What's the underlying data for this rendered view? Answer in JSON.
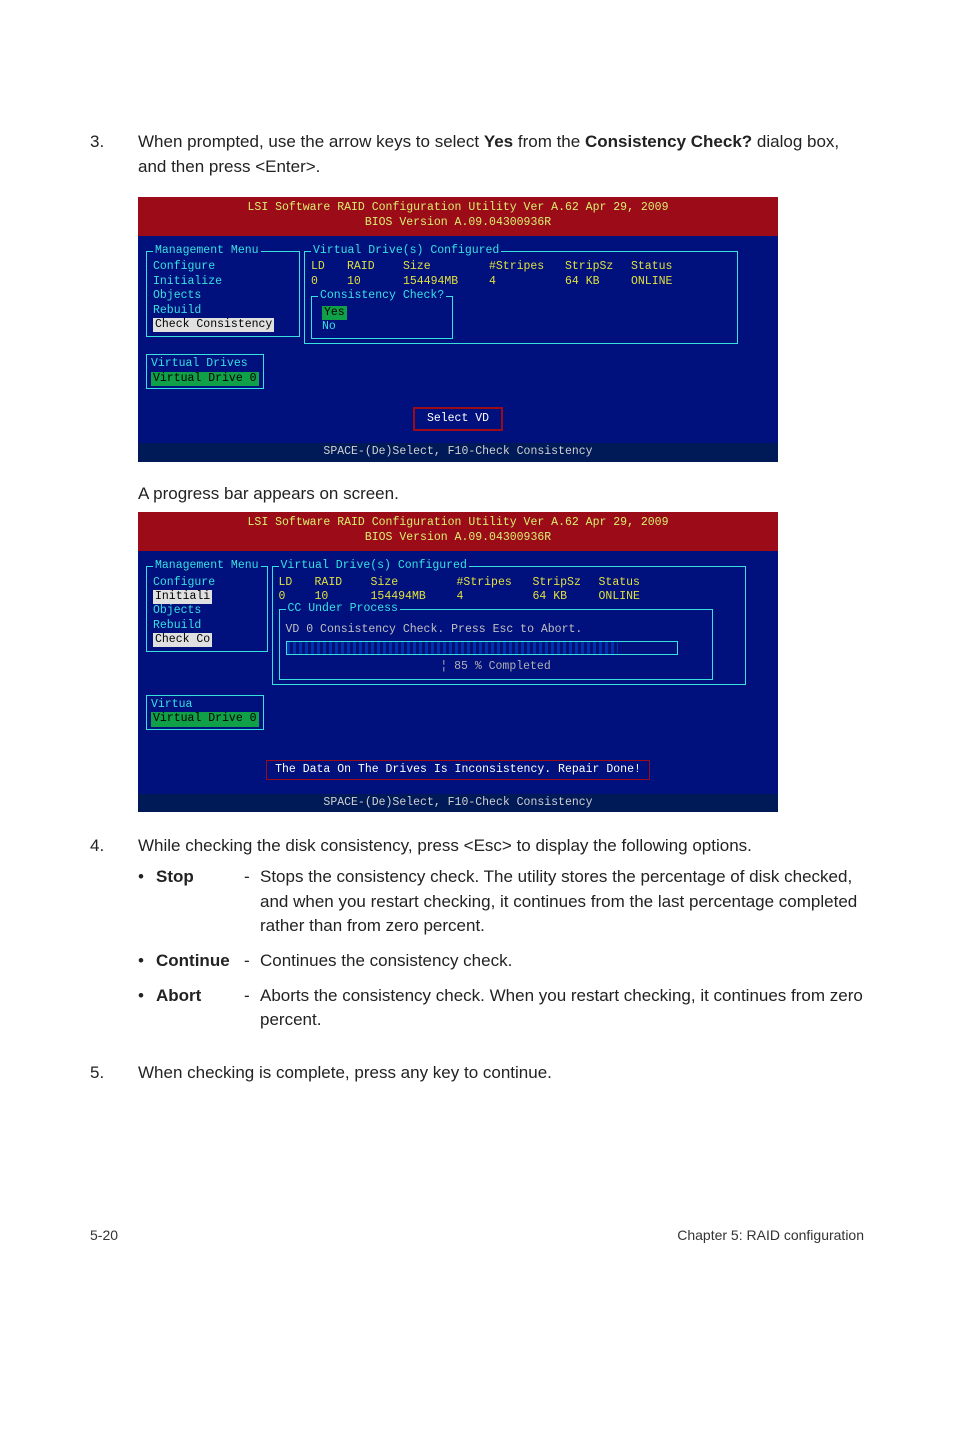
{
  "step3": {
    "num": "3.",
    "text_parts": {
      "p1": "When prompted, use the arrow keys to select ",
      "yes": "Yes",
      "p2": " from the ",
      "cc": "Consistency Check?",
      "p3": " dialog box, and then press <Enter>."
    }
  },
  "term1": {
    "header_line1": "LSI Software RAID Configuration Utility Ver A.62 Apr 29, 2009",
    "header_line2": "BIOS Version   A.09.04300936R",
    "vd_title": "Virtual Drive(s) Configured",
    "mgmt_title": "Management Menu",
    "mgmt_items": [
      "Configure",
      "Initialize",
      "Objects",
      "Rebuild",
      "Check Consistency"
    ],
    "vd_drives_title": "Virtual Drives",
    "vd_drive0": "Virtual Drive 0",
    "cols": {
      "ld": "LD",
      "raid": "RAID",
      "size": "Size",
      "stripes": "#Stripes",
      "stripsz": "StripSz",
      "status": "Status"
    },
    "row": {
      "ld": "0",
      "raid": "10",
      "size": "154494MB",
      "stripes": "4",
      "stripsz": "64 KB",
      "status": "ONLINE"
    },
    "cc_title": "Consistency Check?",
    "cc_yes": "Yes",
    "cc_no": "No",
    "select_vd": "Select VD",
    "footer": "SPACE-(De)Select,    F10-Check Consistency"
  },
  "caption1": "A progress bar appears on screen.",
  "term2": {
    "header_line1": "LSI Software RAID Configuration Utility Ver A.62 Apr 29, 2009",
    "header_line2": "BIOS Version   A.09.04300936R",
    "vd_title": "Virtual Drive(s) Configured",
    "mgmt_title": "Management Menu",
    "mgmt_items": [
      "Configure",
      "Initiali",
      "Objects",
      "Rebuild",
      "Check Co"
    ],
    "cols": {
      "ld": "LD",
      "raid": "RAID",
      "size": "Size",
      "stripes": "#Stripes",
      "stripsz": "StripSz",
      "status": "Status"
    },
    "row": {
      "ld": "0",
      "raid": "10",
      "size": "154494MB",
      "stripes": "4",
      "stripsz": "64 KB",
      "status": "ONLINE"
    },
    "cc_under": "CC Under Process",
    "progress_msg": "VD 0 Consistency Check. Press Esc to Abort.",
    "progress_pct_text": "¦ 85 % Completed",
    "progress_pct": 85,
    "vd_box_title": "Virtua",
    "vd_drive0": "Virtual Drive 0",
    "repair_msg": "The Data On The Drives Is Inconsistency. Repair Done!",
    "footer": "SPACE-(De)Select,    F10-Check Consistency"
  },
  "step4": {
    "num": "4.",
    "intro": "While checking the disk consistency, press <Esc> to display the following options.",
    "options": [
      {
        "label": "Stop",
        "dash": "-",
        "desc": "Stops the consistency check. The utility stores the percentage of disk checked, and when you restart checking, it continues from the last percentage completed rather than from zero percent."
      },
      {
        "label": "Continue",
        "dash": "-",
        "desc": "Continues the consistency check."
      },
      {
        "label": "Abort",
        "dash": "-",
        "desc": "Aborts the consistency check. When you restart checking, it continues from zero percent."
      }
    ]
  },
  "step5": {
    "num": "5.",
    "text": "When checking is complete, press any key to continue."
  },
  "footer": {
    "left": "5-20",
    "right": "Chapter 5: RAID configuration"
  }
}
